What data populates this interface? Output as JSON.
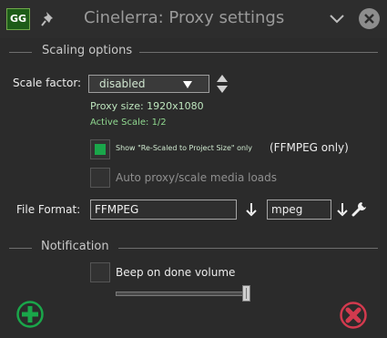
{
  "window": {
    "app_icon": "GG",
    "title": "Cinelerra: Proxy settings"
  },
  "scaling": {
    "section_label": "Scaling options",
    "scale_factor_label": "Scale factor:",
    "scale_factor_value": "disabled",
    "proxy_size": "Proxy size:  1920x1080",
    "active_scale": "Active Scale: 1/2",
    "rescaled_label": "Show \"Re-Scaled to Project Size\" only",
    "rescaled_suffix": "(FFMPEG only)",
    "rescaled_checked": true,
    "auto_proxy_label": "Auto proxy/scale media loads",
    "auto_proxy_checked": false,
    "file_format_label": "File Format:",
    "file_format_value": "FFMPEG",
    "codec_value": "mpeg"
  },
  "notification": {
    "section_label": "Notification",
    "beep_label": "Beep on done volume",
    "beep_checked": false,
    "volume_level": 1.0
  },
  "icons": {
    "pin": "pin-icon",
    "minimize": "chevron-down-icon",
    "close": "close-icon",
    "spin": "spin-arrows-icon",
    "format_down": "down-arrow-icon",
    "settings": "wrench-icon",
    "ok": "plus-circle-icon",
    "cancel": "x-circle-icon"
  },
  "colors": {
    "accent_green": "#1aa64a",
    "cancel_red": "#d23a4e",
    "background": "#2b2b2b"
  }
}
